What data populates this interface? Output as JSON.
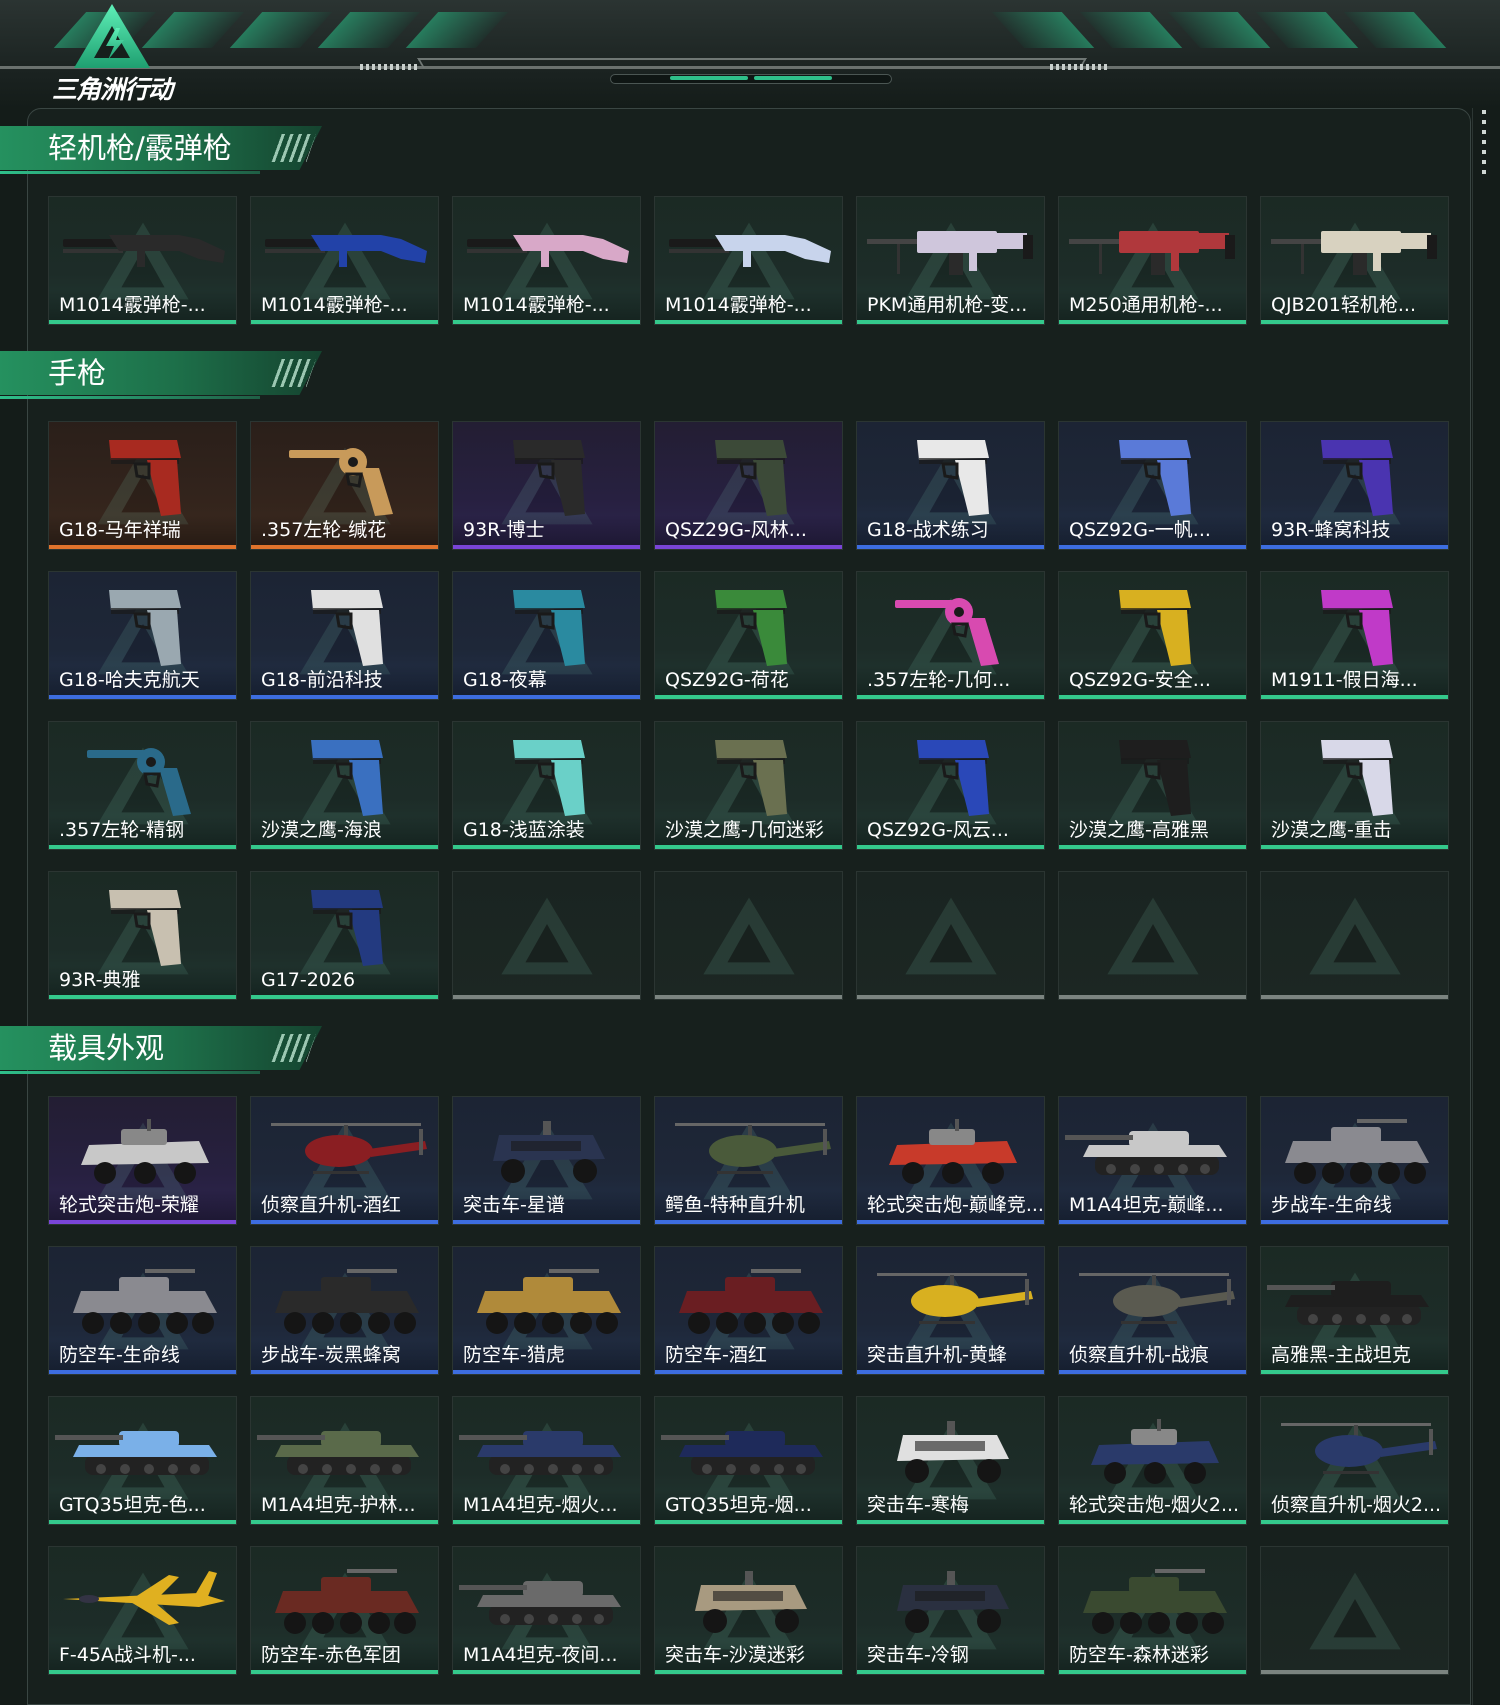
{
  "header": {
    "logo_text": "三角洲行动"
  },
  "colors": {
    "accent": "#2fbf8a",
    "rarity_green": "#34c98c",
    "rarity_blue": "#3d6de0",
    "rarity_purple": "#7a45d8",
    "rarity_orange": "#e0732c",
    "empty": "#7b8480"
  },
  "sections": [
    {
      "title": "轻机枪/霰弹枪",
      "items": [
        {
          "label": "M1014霰弹枪-...",
          "rarity": "green",
          "icon": "shotgun-icon",
          "tint": "#2a2a2a"
        },
        {
          "label": "M1014霰弹枪-...",
          "rarity": "green",
          "icon": "shotgun-icon",
          "tint": "#2242a8"
        },
        {
          "label": "M1014霰弹枪-...",
          "rarity": "green",
          "icon": "shotgun-icon",
          "tint": "#d8a8c8"
        },
        {
          "label": "M1014霰弹枪-...",
          "rarity": "green",
          "icon": "shotgun-icon",
          "tint": "#c8d4ec"
        },
        {
          "label": "PKM通用机枪-变...",
          "rarity": "green",
          "icon": "machine-gun-icon",
          "tint": "#cfc6dc"
        },
        {
          "label": "M250通用机枪-...",
          "rarity": "green",
          "icon": "machine-gun-icon",
          "tint": "#b0383c"
        },
        {
          "label": "QJB201轻机枪...",
          "rarity": "green",
          "icon": "machine-gun-icon",
          "tint": "#d8d2c0"
        }
      ]
    },
    {
      "title": "手枪",
      "items": [
        {
          "label": "G18-马年祥瑞",
          "rarity": "orange",
          "icon": "pistol-icon",
          "tint": "#a82a20"
        },
        {
          "label": ".357左轮-缄花",
          "rarity": "orange",
          "icon": "revolver-icon",
          "tint": "#c89a5a"
        },
        {
          "label": "93R-博士",
          "rarity": "purple",
          "icon": "pistol-icon",
          "tint": "#2a2a2a"
        },
        {
          "label": "QSZ29G-风林...",
          "rarity": "purple",
          "icon": "pistol-icon",
          "tint": "#3c4a38"
        },
        {
          "label": "G18-战术练习",
          "rarity": "blue",
          "icon": "pistol-icon",
          "tint": "#e8e8e8"
        },
        {
          "label": "QSZ92G-一帆...",
          "rarity": "blue",
          "icon": "pistol-icon",
          "tint": "#5a7ad8"
        },
        {
          "label": "93R-蜂窝科技",
          "rarity": "blue",
          "icon": "pistol-icon",
          "tint": "#4a34b0"
        },
        {
          "label": "G18-哈夫克航天",
          "rarity": "blue",
          "icon": "pistol-icon",
          "tint": "#9aa8b0"
        },
        {
          "label": "G18-前沿科技",
          "rarity": "blue",
          "icon": "pistol-icon",
          "tint": "#e0e0e0"
        },
        {
          "label": "G18-夜幕",
          "rarity": "blue",
          "icon": "pistol-icon",
          "tint": "#2a8aa0"
        },
        {
          "label": "QSZ92G-荷花",
          "rarity": "green",
          "icon": "pistol-icon",
          "tint": "#3a8a3a"
        },
        {
          "label": ".357左轮-几何...",
          "rarity": "green",
          "icon": "revolver-icon",
          "tint": "#d84ab0"
        },
        {
          "label": "QSZ92G-安全...",
          "rarity": "green",
          "icon": "pistol-icon",
          "tint": "#d8b020"
        },
        {
          "label": "M1911-假日海...",
          "rarity": "green",
          "icon": "pistol-icon",
          "tint": "#c03ac8"
        },
        {
          "label": ".357左轮-精钢",
          "rarity": "green",
          "icon": "revolver-icon",
          "tint": "#2a6a8a"
        },
        {
          "label": "沙漠之鹰-海浪",
          "rarity": "green",
          "icon": "pistol-icon",
          "tint": "#3a70c0"
        },
        {
          "label": "G18-浅蓝涂装",
          "rarity": "green",
          "icon": "pistol-icon",
          "tint": "#6ad0c8"
        },
        {
          "label": "沙漠之鹰-几何迷彩",
          "rarity": "green",
          "icon": "pistol-icon",
          "tint": "#6a7050"
        },
        {
          "label": "QSZ92G-风云...",
          "rarity": "green",
          "icon": "pistol-icon",
          "tint": "#2a48b8"
        },
        {
          "label": "沙漠之鹰-高雅黑",
          "rarity": "green",
          "icon": "pistol-icon",
          "tint": "#1e1e1e"
        },
        {
          "label": "沙漠之鹰-重击",
          "rarity": "green",
          "icon": "pistol-icon",
          "tint": "#d8d8e8"
        },
        {
          "label": "93R-典雅",
          "rarity": "green",
          "icon": "pistol-icon",
          "tint": "#c8c0b0"
        },
        {
          "label": "G17-2026",
          "rarity": "green",
          "icon": "pistol-icon",
          "tint": "#233a80"
        },
        {
          "label": "",
          "rarity": "empty"
        },
        {
          "label": "",
          "rarity": "empty"
        },
        {
          "label": "",
          "rarity": "empty"
        },
        {
          "label": "",
          "rarity": "empty"
        },
        {
          "label": "",
          "rarity": "empty"
        }
      ]
    },
    {
      "title": "载具外观",
      "items": [
        {
          "label": "轮式突击炮-荣耀",
          "rarity": "purple",
          "icon": "armored-car-icon",
          "tint": "#c8c8c8"
        },
        {
          "label": "侦察直升机-酒红",
          "rarity": "blue",
          "icon": "helicopter-icon",
          "tint": "#8a1e22"
        },
        {
          "label": "突击车-星谱",
          "rarity": "blue",
          "icon": "assault-vehicle-icon",
          "tint": "#2a3450"
        },
        {
          "label": "鳄鱼-特种直升机",
          "rarity": "blue",
          "icon": "helicopter-icon",
          "tint": "#4a5a3a"
        },
        {
          "label": "轮式突击炮-巅峰竞...",
          "rarity": "blue",
          "icon": "armored-car-icon",
          "tint": "#c83a2a"
        },
        {
          "label": "M1A4坦克-巅峰...",
          "rarity": "blue",
          "icon": "tank-icon",
          "tint": "#c8c8c8"
        },
        {
          "label": "步战车-生命线",
          "rarity": "blue",
          "icon": "ifv-icon",
          "tint": "#8a8a90"
        },
        {
          "label": "防空车-生命线",
          "rarity": "blue",
          "icon": "ifv-icon",
          "tint": "#8a8a90"
        },
        {
          "label": "步战车-炭黑蜂窝",
          "rarity": "blue",
          "icon": "ifv-icon",
          "tint": "#2a2a2a"
        },
        {
          "label": "防空车-猎虎",
          "rarity": "blue",
          "icon": "ifv-icon",
          "tint": "#b08a3a"
        },
        {
          "label": "防空车-酒红",
          "rarity": "blue",
          "icon": "ifv-icon",
          "tint": "#6a1e22"
        },
        {
          "label": "突击直升机-黄蜂",
          "rarity": "blue",
          "icon": "helicopter-icon",
          "tint": "#d8b020"
        },
        {
          "label": "侦察直升机-战痕",
          "rarity": "blue",
          "icon": "helicopter-icon",
          "tint": "#5a5a50"
        },
        {
          "label": "高雅黑-主战坦克",
          "rarity": "green",
          "icon": "tank-icon",
          "tint": "#1e1e1e"
        },
        {
          "label": "GTQ35坦克-色...",
          "rarity": "green",
          "icon": "tank-icon",
          "tint": "#7ab0e8"
        },
        {
          "label": "M1A4坦克-护林...",
          "rarity": "green",
          "icon": "tank-icon",
          "tint": "#5a6a4a"
        },
        {
          "label": "M1A4坦克-烟火...",
          "rarity": "green",
          "icon": "tank-icon",
          "tint": "#2a3a6a"
        },
        {
          "label": "GTQ35坦克-烟...",
          "rarity": "green",
          "icon": "tank-icon",
          "tint": "#1e2a5a"
        },
        {
          "label": "突击车-寒梅",
          "rarity": "green",
          "icon": "assault-vehicle-icon",
          "tint": "#e0e0e0"
        },
        {
          "label": "轮式突击炮-烟火2...",
          "rarity": "green",
          "icon": "armored-car-icon",
          "tint": "#2a3a6a"
        },
        {
          "label": "侦察直升机-烟火2...",
          "rarity": "green",
          "icon": "helicopter-icon",
          "tint": "#2a3a6a"
        },
        {
          "label": "F-45A战斗机-...",
          "rarity": "green",
          "icon": "fighter-jet-icon",
          "tint": "#e0b020"
        },
        {
          "label": "防空车-赤色军团",
          "rarity": "green",
          "icon": "ifv-icon",
          "tint": "#6a2a22"
        },
        {
          "label": "M1A4坦克-夜间...",
          "rarity": "green",
          "icon": "tank-icon",
          "tint": "#6a6a6a"
        },
        {
          "label": "突击车-沙漠迷彩",
          "rarity": "green",
          "icon": "assault-vehicle-icon",
          "tint": "#a89a80"
        },
        {
          "label": "突击车-冷钢",
          "rarity": "green",
          "icon": "assault-vehicle-icon",
          "tint": "#2a3040"
        },
        {
          "label": "防空车-森林迷彩",
          "rarity": "green",
          "icon": "ifv-icon",
          "tint": "#3a4a30"
        },
        {
          "label": "",
          "rarity": "empty"
        }
      ]
    }
  ]
}
